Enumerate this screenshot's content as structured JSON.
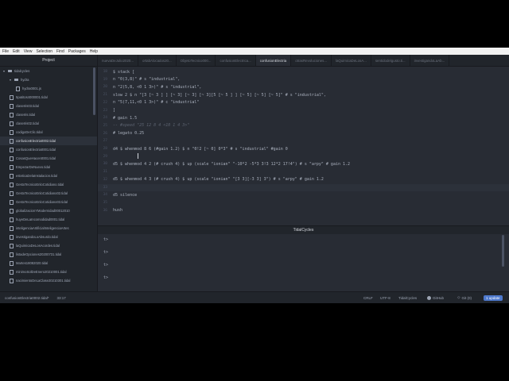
{
  "menu": [
    "File",
    "Edit",
    "View",
    "Selection",
    "Find",
    "Packages",
    "Help"
  ],
  "project": {
    "title": "Project",
    "items": [
      {
        "label": "tidalcycles",
        "type": "folder-open",
        "depth": 0
      },
      {
        "label": "hydra",
        "type": "folder-open",
        "depth": 1
      },
      {
        "label": "hydra0001.js",
        "type": "file",
        "depth": 2
      },
      {
        "label": "5patitos4000001.tidal",
        "type": "file",
        "depth": 1
      },
      {
        "label": "claseIris03.tidal",
        "type": "file",
        "depth": 1
      },
      {
        "label": "claseIris.tidal",
        "type": "file",
        "depth": 1
      },
      {
        "label": "claseIris02.tidal",
        "type": "file",
        "depth": 1
      },
      {
        "label": "codigoDeClic.tidal",
        "type": "file",
        "depth": 1
      },
      {
        "label": "confusionElectria0002.tidal",
        "type": "file",
        "depth": 1,
        "selected": true
      },
      {
        "label": "confusionElectria0001.tidal",
        "type": "file",
        "depth": 1
      },
      {
        "label": "CosasQueHacen0001.tidal",
        "type": "file",
        "depth": 1
      },
      {
        "label": "EmpezarDeNuevo.tidal",
        "type": "file",
        "depth": 1
      },
      {
        "label": "esteticaDelaInstalacion.tidal",
        "type": "file",
        "depth": 1
      },
      {
        "label": "GestoTecnicoEnloCotidiano.tidal",
        "type": "file",
        "depth": 1
      },
      {
        "label": "GestoTecnicoEnloCotidiano02.tidal",
        "type": "file",
        "depth": 1
      },
      {
        "label": "GestoTecnicoEnloCotidiano03.tidal",
        "type": "file",
        "depth": 1
      },
      {
        "label": "globalizacionYModernidad00012010",
        "type": "file",
        "depth": 1
      },
      {
        "label": "huyeDeLaIncomodidad0001.tidal",
        "type": "file",
        "depth": 1
      },
      {
        "label": "inteligenciaArtificialInteligenciaArtes",
        "type": "file",
        "depth": 1
      },
      {
        "label": "investigandoLoAbsurdo.tidal",
        "type": "file",
        "depth": 1
      },
      {
        "label": "laQuimicaDeLosAcordes.tidal",
        "type": "file",
        "depth": 1
      },
      {
        "label": "listadeOpciones20200731.tidal",
        "type": "file",
        "depth": 1
      },
      {
        "label": "Martes18082020.tidal",
        "type": "file",
        "depth": 1
      },
      {
        "label": "minimoSolDeEnero20210001.tidal",
        "type": "file",
        "depth": 1
      },
      {
        "label": "nacimientoDeLaClase20210301.tidal",
        "type": "file",
        "depth": 1
      }
    ]
  },
  "tabs": [
    {
      "label": "nuevaDeJulio2020...",
      "active": false
    },
    {
      "label": "ortabAlocados20...",
      "active": false
    },
    {
      "label": "ObjetoTecnico000...",
      "active": false
    },
    {
      "label": "confusionElectrica...",
      "active": false
    },
    {
      "label": "confusionElectria",
      "active": true
    },
    {
      "label": "otrasRevoluciones...",
      "active": false
    },
    {
      "label": "laQuimicaDeLosA...",
      "active": false
    },
    {
      "label": "sentidodelgusto.ti...",
      "active": false
    },
    {
      "label": "investigandoLaAb...",
      "active": false
    }
  ],
  "editor": {
    "lines": [
      {
        "n": "18",
        "text": "$ stack [",
        "kind": "code"
      },
      {
        "n": "19",
        "text": "n \"0(3,8)\" # s \"industrial\",",
        "kind": "code"
      },
      {
        "n": "20",
        "text": "n \"2(5,8, <0 1 3>)\" # s \"industrial\",",
        "kind": "code"
      },
      {
        "n": "21",
        "text": "slow 2 $ n \"[3 [~ 3 ] ] [~ 3] [~ 3] [~ 3][5 [~ 5 ] ] [~ 5] [~ 5] [~ 5]\" # s \"industrial\",",
        "kind": "code"
      },
      {
        "n": "22",
        "text": "n \"5(7,11,<0 1 3>)\" # c \"industrial\"",
        "kind": "code"
      },
      {
        "n": "23",
        "text": "]",
        "kind": "code"
      },
      {
        "n": "24",
        "text": "# gain 1.5",
        "kind": "code"
      },
      {
        "n": "25",
        "text": "-- #speed \"25 12 8 4 <10 1 4 3>\"",
        "kind": "comment"
      },
      {
        "n": "26",
        "text": "# legato 0.25",
        "kind": "code"
      },
      {
        "n": "27",
        "text": "",
        "kind": "code"
      },
      {
        "n": "28",
        "text": "d4 $ whenmod 8 6 (#gain 1.2) $ n \"0!2 [~ 0] 0*3\" # s \"industrial\" #gain 0",
        "kind": "code"
      },
      {
        "n": "29",
        "text": "",
        "kind": "code"
      },
      {
        "n": "30",
        "text": "d5 $ whenmod 4 2 (# crush 4) $ up (scale \"ionian\" \"-10*2 -5*3 3!3 12*2 17!4\") # s \"arpy\" # gain 1.2",
        "kind": "code"
      },
      {
        "n": "31",
        "text": "",
        "kind": "code"
      },
      {
        "n": "32",
        "text": "d5 $ whenmod 4 3 (# crush 4) $ up (scale \"ionian\" \"[3 3][-3 3] 3\") # s \"arpy\" # gain 1.2",
        "kind": "code"
      },
      {
        "n": "33",
        "text": "",
        "kind": "code"
      },
      {
        "n": "34",
        "text": "d5 silence",
        "kind": "code"
      },
      {
        "n": "35",
        "text": "",
        "kind": "code"
      },
      {
        "n": "36",
        "text": "hush",
        "kind": "code"
      }
    ]
  },
  "console": {
    "title": "TidalCycles",
    "lines": [
      "t>",
      "t>",
      "t>",
      "t>"
    ]
  },
  "status": {
    "file": "confusionElectria0002.tidal*",
    "position": "33:17",
    "line_ending": "CRLF",
    "encoding": "UTF-8",
    "grammar": "TidalCycles",
    "github": "GitHub",
    "git": "Git (0)",
    "update": "1 update"
  }
}
